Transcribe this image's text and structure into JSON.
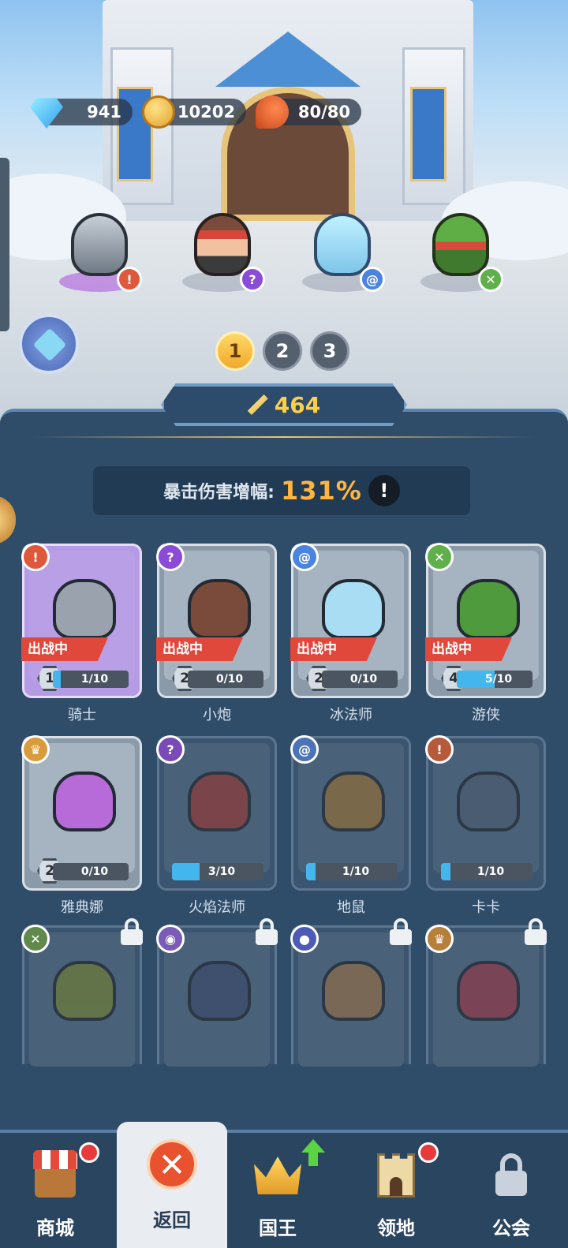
{
  "resources": {
    "gems": "941",
    "coins": "10202",
    "stamina": "80/80"
  },
  "team": {
    "pages": [
      "1",
      "2",
      "3"
    ],
    "active_page": "1"
  },
  "power": "464",
  "crit": {
    "label": "暴击伤害增幅:",
    "value": "131%",
    "info": "!"
  },
  "heroes": [
    {
      "name": "骑士",
      "level": "1",
      "progress": "1/10",
      "fill": 0.1,
      "tag": "出战中",
      "element_color": "#e0583b",
      "element_icon": "sword-icon",
      "color": "#9aa3ad",
      "frame": "purple"
    },
    {
      "name": "小炮",
      "level": "2",
      "progress": "0/10",
      "fill": 0.0,
      "tag": "出战中",
      "element_color": "#8a4bd6",
      "element_icon": "magic-icon",
      "color": "#7a4a3a",
      "frame": "normal"
    },
    {
      "name": "冰法师",
      "level": "2",
      "progress": "0/10",
      "fill": 0.0,
      "tag": "出战中",
      "element_color": "#4b84e0",
      "element_icon": "swirl-icon",
      "color": "#a8ddf4",
      "frame": "normal"
    },
    {
      "name": "游侠",
      "level": "4",
      "progress": "5/10",
      "fill": 0.5,
      "tag": "出战中",
      "element_color": "#5fb04b",
      "element_icon": "leaf-icon",
      "color": "#4f9a3d",
      "frame": "normal"
    },
    {
      "name": "雅典娜",
      "level": "2",
      "progress": "0/10",
      "fill": 0.0,
      "element_color": "#d99c3c",
      "element_icon": "crown-icon",
      "color": "#b66bd8",
      "frame": "normal"
    },
    {
      "name": "火焰法师",
      "progress": "3/10",
      "fill": 0.3,
      "element_color": "#7a4bb6",
      "element_icon": "magic-icon",
      "color": "#8a3b3b",
      "frame": "dim"
    },
    {
      "name": "地鼠",
      "progress": "1/10",
      "fill": 0.1,
      "element_color": "#4b74b6",
      "element_icon": "swirl-icon",
      "color": "#8a6b3b",
      "frame": "dim"
    },
    {
      "name": "卡卡",
      "progress": "1/10",
      "fill": 0.1,
      "element_color": "#b65a3b",
      "element_icon": "sword-icon",
      "color": "#4b5b70",
      "frame": "dim"
    },
    {
      "element_color": "#5f8a4b",
      "element_icon": "leaf-icon",
      "color": "#6b7a3b",
      "frame": "dim",
      "locked": true
    },
    {
      "element_color": "#7a5bb6",
      "element_icon": "eye-icon",
      "color": "#3b4b6a",
      "frame": "dim",
      "locked": true
    },
    {
      "element_color": "#4b5bb6",
      "element_icon": "paw-icon",
      "color": "#8a6b4b",
      "frame": "dim",
      "locked": true
    },
    {
      "element_color": "#b6803b",
      "element_icon": "crown-icon",
      "color": "#8a3b4b",
      "frame": "dim",
      "locked": true
    }
  ],
  "nav": [
    {
      "label": "商城",
      "icon": "shop-icon",
      "badge": "dot"
    },
    {
      "label": "返回",
      "icon": "close-icon",
      "active": true
    },
    {
      "label": "国王",
      "icon": "crown-icon",
      "badge": "arrow"
    },
    {
      "label": "领地",
      "icon": "castle-icon",
      "badge": "dot"
    },
    {
      "label": "公会",
      "icon": "lock-icon"
    }
  ]
}
